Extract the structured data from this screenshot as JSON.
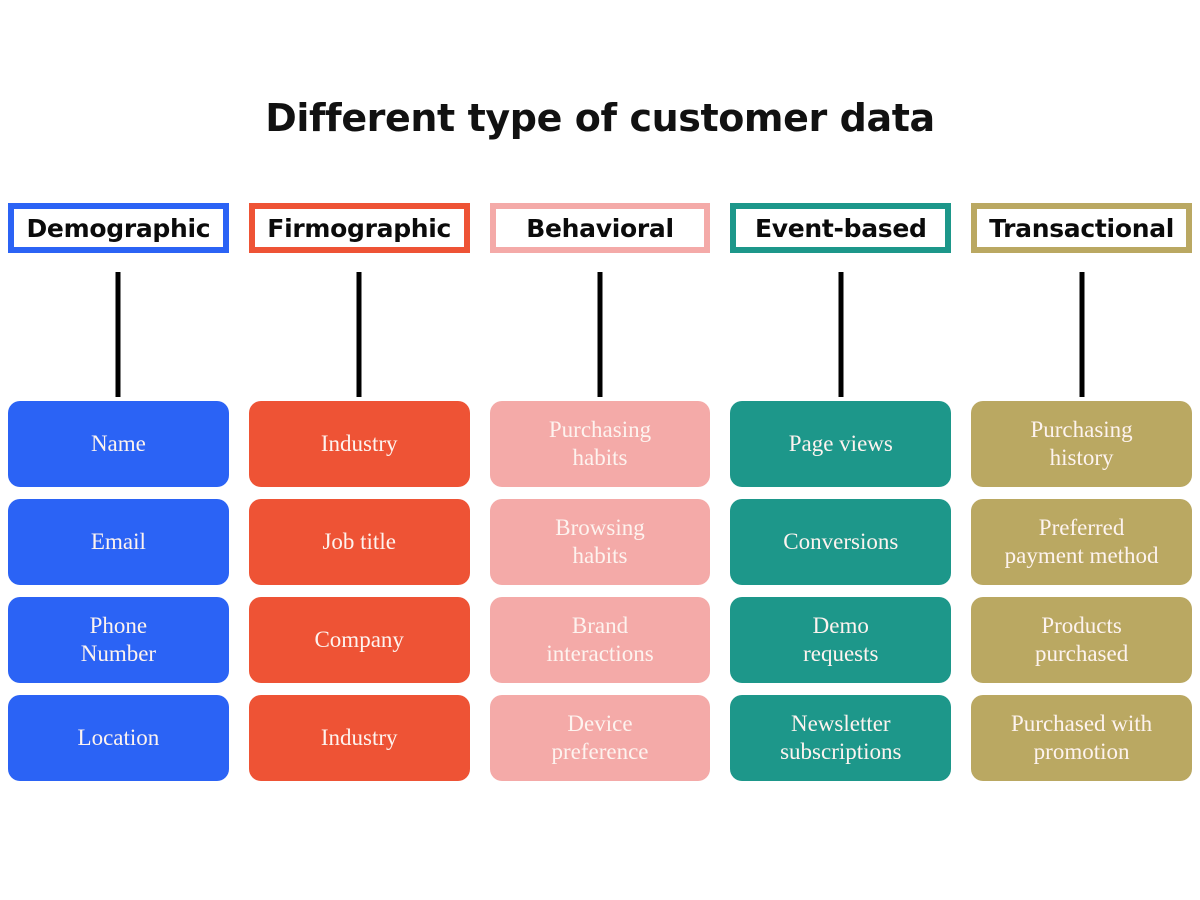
{
  "title": "Different type of customer data",
  "palette": {
    "background": "#ffffff",
    "connector": "#000000",
    "header_text": "#0b0b0b",
    "cell_text": "#fdf3ef"
  },
  "columns": [
    {
      "id": "demographic",
      "header": "Demographic",
      "accent": "#2b63f5",
      "cell_fill": "#2b63f5",
      "items": [
        "Name",
        "Email",
        "Phone\nNumber",
        "Location"
      ]
    },
    {
      "id": "firmographic",
      "header": "Firmographic",
      "accent": "#ee5335",
      "cell_fill": "#ee5335",
      "items": [
        "Industry",
        "Job title",
        "Company",
        "Industry"
      ]
    },
    {
      "id": "behavioral",
      "header": "Behavioral",
      "accent": "#f4aaa8",
      "cell_fill": "#f4aaa8",
      "items": [
        "Purchasing\nhabits",
        "Browsing\nhabits",
        "Brand\ninteractions",
        "Device\npreference"
      ]
    },
    {
      "id": "event-based",
      "header": "Event-based",
      "accent": "#1d978a",
      "cell_fill": "#1d978a",
      "items": [
        "Page views",
        "Conversions",
        "Demo\nrequests",
        "Newsletter\nsubscriptions"
      ]
    },
    {
      "id": "transactional",
      "header": "Transactional",
      "accent": "#baa862",
      "cell_fill": "#baa862",
      "items": [
        "Purchasing\nhistory",
        "Preferred\npayment method",
        "Products\npurchased",
        "Purchased with\npromotion"
      ]
    }
  ]
}
